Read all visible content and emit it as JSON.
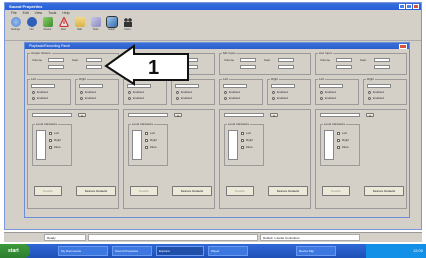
{
  "window": {
    "title": "Sound Properties",
    "menu": [
      "File",
      "Edit",
      "View",
      "Tools",
      "Help"
    ]
  },
  "toolbar": {
    "items": [
      {
        "label": "Settings",
        "icon": "gear-globe-icon",
        "color": "#4a7fcf"
      },
      {
        "label": "Info",
        "icon": "info-icon",
        "color": "#2f5fb8"
      },
      {
        "label": "Device",
        "icon": "device-icon",
        "color": "#5a9a3a"
      },
      {
        "label": "Alert",
        "icon": "warning-icon",
        "color": "#cc3333"
      },
      {
        "label": "Mail",
        "icon": "mail-icon",
        "color": "#d8b24a"
      },
      {
        "label": "Tools",
        "icon": "wrench-icon",
        "color": "#8a8ac0"
      },
      {
        "label": "Graph",
        "icon": "chart-icon",
        "color": "#3a6aa8"
      },
      {
        "label": "Users",
        "icon": "people-icon",
        "color": "#333333"
      }
    ]
  },
  "inner": {
    "title": "Playback/Recording Panel"
  },
  "callout": {
    "number": "1"
  },
  "panels": [
    {
      "group1": "Output Volume",
      "group2": "Left",
      "group3": "Right",
      "opt": [
        "Enabled",
        "Enabled"
      ],
      "field": "Volume",
      "gain": "Gain",
      "section": "Level Indicators",
      "rows": [
        "Left",
        "Right",
        "Mute"
      ],
      "btn1": "Disable",
      "btn2": "Restore Defaults"
    },
    {
      "group1": "Line In",
      "group2": "Left",
      "group3": "Right",
      "opt": [
        "Enabled",
        "Enabled"
      ],
      "field": "Volume",
      "gain": "Gain",
      "section": "Level Indicators",
      "rows": [
        "Left",
        "Right",
        "Mute"
      ],
      "btn1": "Disable",
      "btn2": "Restore Defaults"
    },
    {
      "group1": "Mic Input",
      "group2": "Left",
      "group3": "Right",
      "opt": [
        "Enabled",
        "Enabled"
      ],
      "field": "Volume",
      "gain": "Gain",
      "section": "Level Indicators",
      "rows": [
        "Left",
        "Right",
        "Mute"
      ],
      "btn1": "Disable",
      "btn2": "Restore Defaults"
    },
    {
      "group1": "Aux Input",
      "group2": "Left",
      "group3": "Right",
      "opt": [
        "Enabled",
        "Enabled"
      ],
      "field": "Volume",
      "gain": "Gain",
      "section": "Level Indicators",
      "rows": [
        "Left",
        "Right",
        "Mute"
      ],
      "btn1": "Disable",
      "btn2": "Restore Defaults"
    }
  ],
  "status": {
    "left": "Ready",
    "middle": "Default: 1 Audio Controllers"
  },
  "taskbar": {
    "start": "start",
    "items": [
      "My Documents",
      "Sound Properties",
      "Explorer",
      "Player",
      "Device Mgr"
    ],
    "clock": "12:00"
  }
}
